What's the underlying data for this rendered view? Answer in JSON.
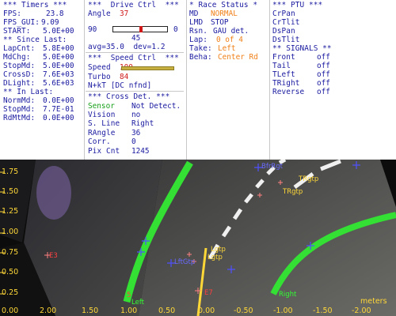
{
  "timers": {
    "header": "*** Timers ***",
    "fps_label": "FPS:",
    "fps_value": "23.8",
    "fpsgui_label": "FPS_GUI:",
    "fpsgui_value": "9.09",
    "start_label": "START:",
    "start_value": "5.0E+00",
    "since_header": "** Since Last:",
    "lapcnt_label": "LapCnt:",
    "lapcnt_value": "5.8E+00",
    "mdchg_label": "MdChg:",
    "mdchg_value": "5.0E+00",
    "stopmd_label": "StopMd:",
    "stopmd_value": "5.0E+00",
    "crossd_label": "CrossD:",
    "crossd_value": "7.6E+03",
    "dlight_label": "DLight:",
    "dlight_value": "5.6E+03",
    "inlast_header": "** In Last:",
    "normmd_label": "NormMd:",
    "normmd_value": "0.0E+00",
    "stopmd2_label": "StopMd:",
    "stopmd2_value": "7.7E-01",
    "rdmtmd_label": "RdMtMd:",
    "rdmtmd_value": "0.0E+00"
  },
  "drive": {
    "header": "***  Drive Ctrl  ***",
    "angle_label": "Angle",
    "angle_value": "37",
    "slider_min": "90",
    "slider_max": "0",
    "slider_value": "45",
    "slider_fraction": 0.5,
    "avg_text": "avg=35.0  dev=1.2",
    "speed_header": "***  Speed Ctrl  ***",
    "speed_label": "Speed",
    "speed_value": "100",
    "turbo_label": "Turbo",
    "turbo_value": "84",
    "nkt_text": "N+kT [DC nfnd]",
    "cross_header": "*** Cross Det. ***",
    "sensor_label": "Sensor",
    "sensor_value": "Not Detect.",
    "vision_label": "Vision",
    "vision_value": "no",
    "sline_label": "S. Line",
    "sline_value": "Right",
    "rangle_label": "RAngle",
    "rangle_value": "36",
    "corr_label": "Corr.",
    "corr_value": "0",
    "pixcnt_label": "Pix Cnt",
    "pixcnt_value": "1245"
  },
  "race": {
    "header": "* Race Status *",
    "md_label": "MD",
    "md_value": "NORMAL",
    "lmd_label": "LMD",
    "lmd_value": "STOP",
    "rsn_label": "Rsn.",
    "rsn_value": "GAU det.",
    "lap_label": "Lap:",
    "lap_value": "0 of 4",
    "take_label": "Take:",
    "take_value": "Left",
    "beha_label": "Beha:",
    "beha_value": "Center Rd"
  },
  "ptu": {
    "header": "*** PTU ***",
    "items": [
      "CrPan",
      "CrTlit",
      "DsPan",
      "DsTlit"
    ]
  },
  "signals": {
    "header": "** SIGNALS **",
    "items": [
      {
        "label": "Front",
        "value": "off"
      },
      {
        "label": "Tail",
        "value": "off"
      },
      {
        "label": "TLeft",
        "value": "off"
      },
      {
        "label": "TRight",
        "value": "off"
      },
      {
        "label": "Reverse",
        "value": "off"
      }
    ]
  },
  "camera": {
    "y_ticks": [
      "1.75",
      "1.50",
      "1.25",
      "1.00",
      "0.75",
      "0.50",
      "0.25"
    ],
    "x_ticks": [
      "0.00",
      "2.00",
      "1.50",
      "1.00",
      "0.50",
      "0.00",
      "-0.50",
      "-1.00",
      "-1.50",
      "-2.00"
    ],
    "unit_label": "meters",
    "labels": {
      "left_line": "Left",
      "left_num": "5",
      "right_line": "Right",
      "rgtp1": "TRgtp",
      "rgtp2": "TRgtp",
      "lgtp1": "Lgtp",
      "lgtp2": "Lgtp",
      "bfrg": "BfrRgt",
      "lftg": "LftGtp",
      "e3": "E3",
      "e7": "E7"
    }
  },
  "colors": {
    "label_blue": "#1a1aa0",
    "value_red": "#d01818",
    "value_orange": "#f08018",
    "sensor_green": "#18a018",
    "lane_green": "#33e033",
    "axis_yellow": "#ffd838"
  }
}
